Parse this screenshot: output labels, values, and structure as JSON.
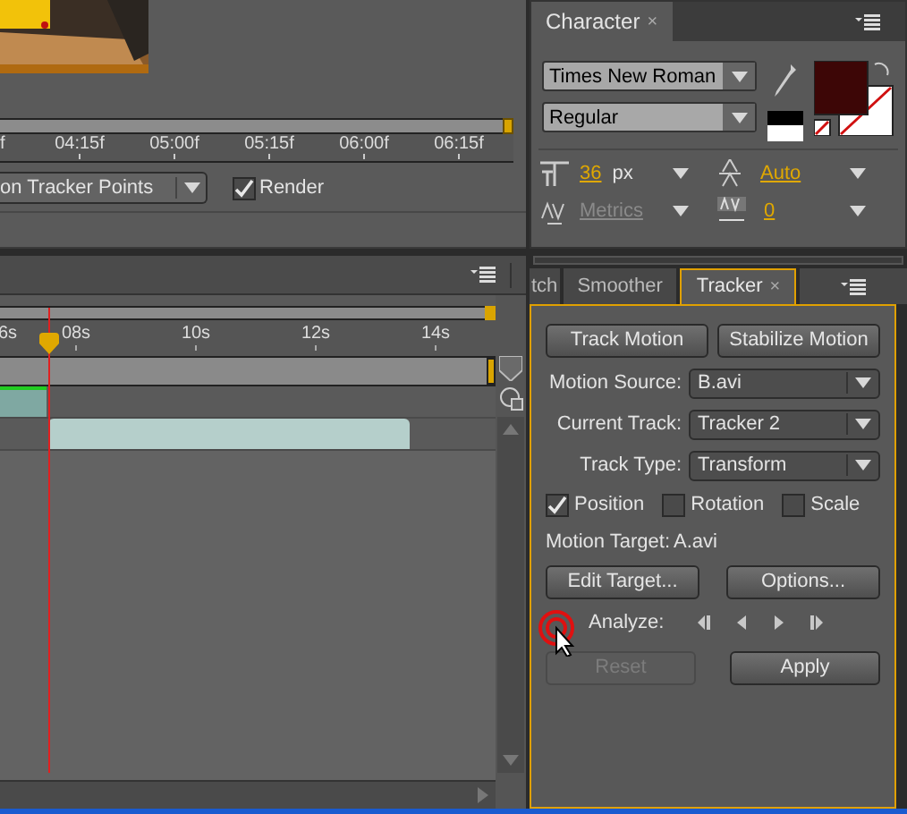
{
  "footage_panel": {
    "ruler_labels": [
      "f",
      "04:15f",
      "05:00f",
      "05:15f",
      "06:00f",
      "06:15f"
    ],
    "view_dropdown": "on Tracker Points",
    "render": {
      "label": "Render",
      "checked": true
    }
  },
  "timeline_panel": {
    "ruler_labels": [
      "6s",
      "08s",
      "10s",
      "12s",
      "14s"
    ]
  },
  "character_panel": {
    "tab": {
      "label": "Character",
      "close": "×"
    },
    "font": "Times New Roman",
    "style": "Regular",
    "font_size": {
      "value": "36",
      "unit": "px"
    },
    "leading": {
      "value": "Auto",
      "disabled": false
    },
    "kerning": {
      "value": "Metrics",
      "disabled": true
    },
    "tracking": {
      "value": "0",
      "disabled": false
    }
  },
  "tracker_panel": {
    "tabs": [
      {
        "label": "tch",
        "selected": false
      },
      {
        "label": "Smoother",
        "selected": false
      },
      {
        "label": "Tracker",
        "close": "×",
        "selected": true
      }
    ],
    "top_buttons": [
      "Track Motion",
      "Stabilize Motion"
    ],
    "fields": [
      {
        "label": "Motion Source:",
        "value": "B.avi"
      },
      {
        "label": "Current Track:",
        "value": "Tracker 2"
      },
      {
        "label": "Track Type:",
        "value": "Transform"
      }
    ],
    "options": [
      {
        "label": "Position",
        "checked": true
      },
      {
        "label": "Rotation",
        "checked": false
      },
      {
        "label": "Scale",
        "checked": false
      }
    ],
    "motion_target": {
      "label": "Motion Target:",
      "value": "A.avi"
    },
    "target_buttons": [
      "Edit Target...",
      "Options..."
    ],
    "analyze_label": "Analyze:",
    "bottom_buttons": [
      {
        "label": "Reset",
        "disabled": true
      },
      {
        "label": "Apply",
        "disabled": false
      }
    ]
  }
}
